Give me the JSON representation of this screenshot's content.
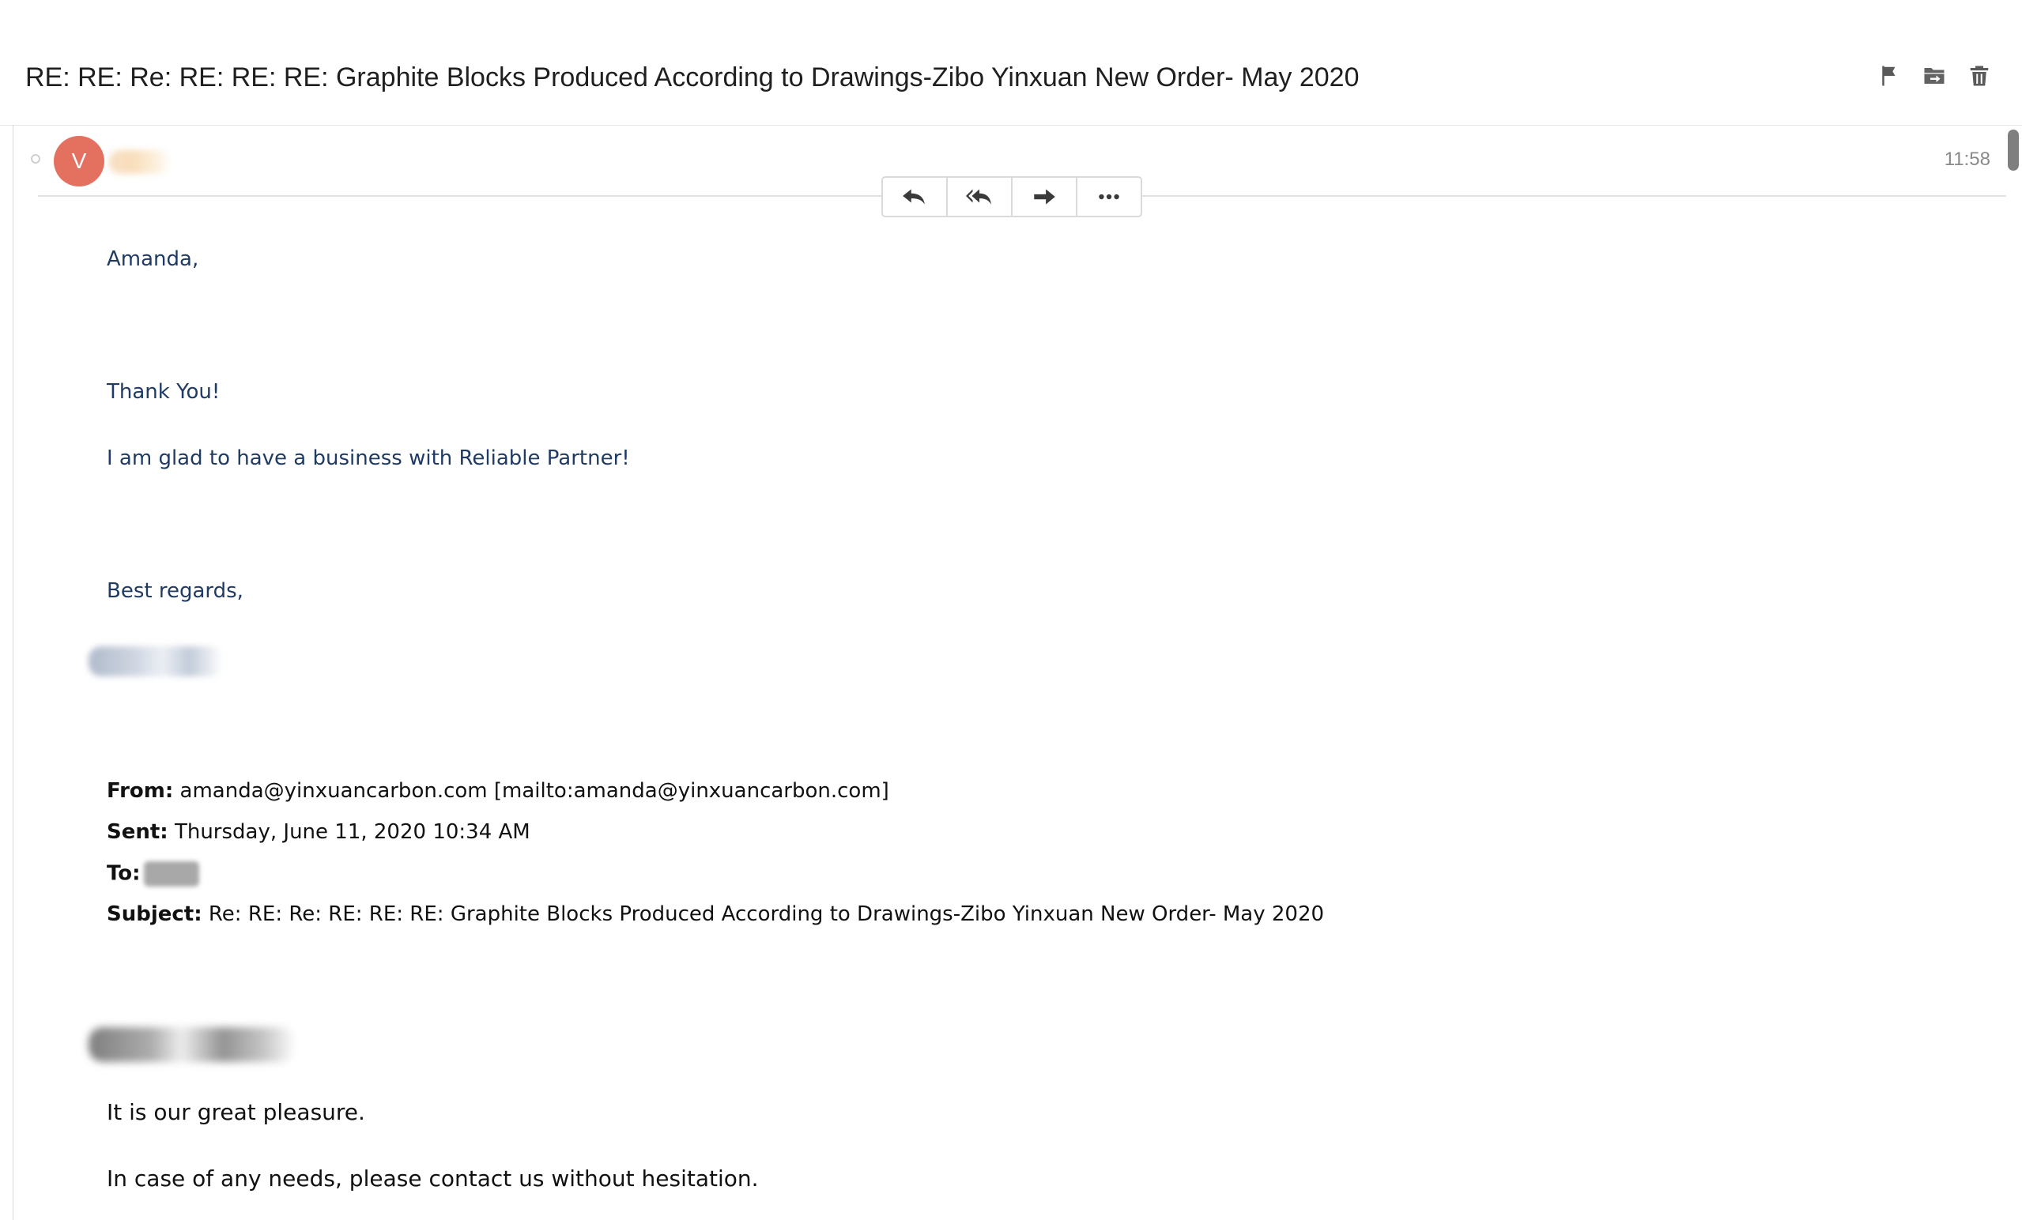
{
  "email": {
    "subject": "RE: RE: Re: RE: RE: RE: Graphite Blocks Produced According to Drawings-Zibo Yinxuan New Order- May 2020",
    "toolbar": {
      "flag_icon": "flag-icon",
      "move_icon": "move-to-folder-icon",
      "delete_icon": "trash-icon"
    },
    "message": {
      "avatar_initial": "V",
      "time": "11:58",
      "actions": [
        "reply-icon",
        "reply-all-icon",
        "forward-icon",
        "more-icon"
      ]
    },
    "body": {
      "greeting": "Amanda,",
      "line1": "Thank You!",
      "line2": "I am glad to have a business with Reliable Partner!",
      "closing": "Best regards,"
    },
    "quoted_header": {
      "from_label": "From:",
      "from_value": "amanda@yinxuancarbon.com [mailto:amanda@yinxuancarbon.com]",
      "sent_label": "Sent:",
      "sent_value": "Thursday, June 11, 2020 10:34 AM",
      "to_label": "To:",
      "subject_label": "Subject:",
      "subject_value": "Re: RE: Re: RE: RE: RE: Graphite Blocks Produced According to Drawings-Zibo Yinxuan New Order- May 2020"
    },
    "quoted_body": {
      "line1": "It is our great pleasure.",
      "line2": "In case of any needs, please contact us without hesitation."
    }
  },
  "colors": {
    "avatar": "#e4705f",
    "body_text_blue": "#1f3b63",
    "time_text": "#8a8a8a"
  }
}
